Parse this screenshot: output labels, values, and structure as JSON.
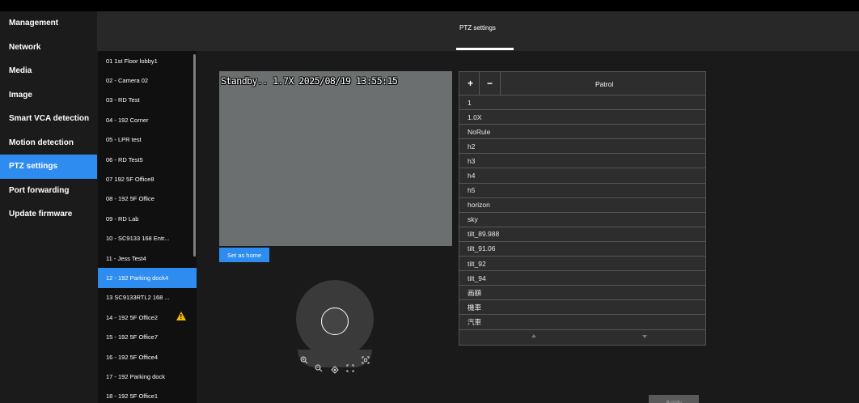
{
  "nav": {
    "items": [
      {
        "label": "Management"
      },
      {
        "label": "Network"
      },
      {
        "label": "Media"
      },
      {
        "label": "Image"
      },
      {
        "label": "Smart VCA detection"
      },
      {
        "label": "Motion detection"
      },
      {
        "label": "PTZ settings",
        "active": true
      },
      {
        "label": "Port forwarding"
      },
      {
        "label": "Update firmware"
      }
    ]
  },
  "header": {
    "tab": "PTZ settings"
  },
  "cameras": [
    {
      "label": "01  1st Floor lobby1"
    },
    {
      "label": "02 - Camera 02"
    },
    {
      "label": "03 - RD Test"
    },
    {
      "label": "04 - 192 Corner"
    },
    {
      "label": "05 - LPR test"
    },
    {
      "label": "06 - RD Test5"
    },
    {
      "label": "07  192 5F Office8"
    },
    {
      "label": "08 - 192 5F Office"
    },
    {
      "label": "09 - RD Lab"
    },
    {
      "label": "10 - SC9133 168 Entr..."
    },
    {
      "label": "11 - Jess Test4"
    },
    {
      "label": "12 - 192 Parking dock4",
      "selected": true
    },
    {
      "label": "13  SC9133RTL2 168 ..."
    },
    {
      "label": "14 - 192 5F Office2",
      "warning": true
    },
    {
      "label": "15 - 192 5F Office7"
    },
    {
      "label": "16 - 192 5F Office4"
    },
    {
      "label": "17 - 192 Parking dock"
    },
    {
      "label": "18 - 192 5F Office1"
    }
  ],
  "video": {
    "overlay": "Standby.. 1.7X 2025/08/19 13:55:15"
  },
  "buttons": {
    "set_home": "Set as home",
    "apply": "Apply"
  },
  "patrol": {
    "plus": "+",
    "minus": "−",
    "title": "Patrol",
    "items": [
      "1",
      "1.0X",
      "NoRule",
      "h2",
      "h3",
      "h4",
      "h5",
      "horizon",
      "sky",
      "tilt_89.988",
      "tilt_91.06",
      "tilt_92",
      "tilt_94",
      "画額",
      "機車",
      "汽車"
    ]
  },
  "icons": {
    "zoom_in": "zoom-in-icon",
    "zoom_out": "zoom-out-icon",
    "center": "center-icon",
    "fit": "fit-icon",
    "fullscreen": "fullscreen-icon",
    "warning": "warning-icon"
  },
  "colors": {
    "accent": "#2e8cf0",
    "warning": "#f5b800"
  }
}
